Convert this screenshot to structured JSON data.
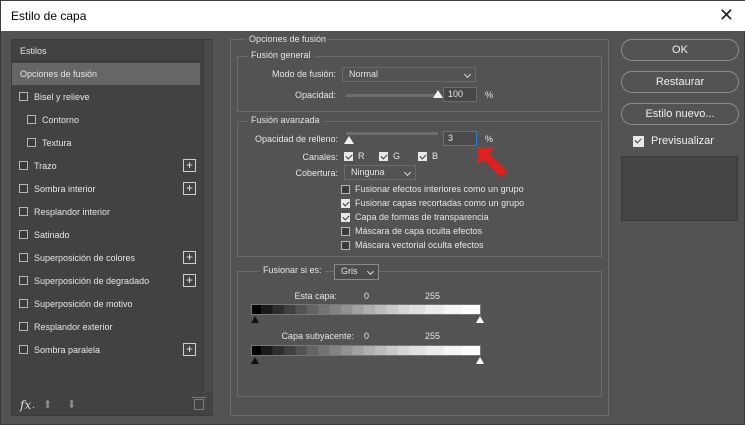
{
  "window": {
    "title": "Estilo de capa",
    "close_glyph": "✕"
  },
  "left_panel": {
    "header": "Estilos",
    "items": [
      {
        "label": "Opciones de fusión",
        "checkbox": false,
        "plus": false,
        "active": true
      },
      {
        "label": "Bisel y relieve",
        "checkbox": true,
        "checked": false,
        "plus": false
      },
      {
        "label": "Contorno",
        "checkbox": true,
        "checked": false,
        "plus": false,
        "indent": true
      },
      {
        "label": "Textura",
        "checkbox": true,
        "checked": false,
        "plus": false,
        "indent": true
      },
      {
        "label": "Trazo",
        "checkbox": true,
        "checked": false,
        "plus": true
      },
      {
        "label": "Sombra interior",
        "checkbox": true,
        "checked": false,
        "plus": true
      },
      {
        "label": "Resplandor interior",
        "checkbox": true,
        "checked": false,
        "plus": false
      },
      {
        "label": "Satinado",
        "checkbox": true,
        "checked": false,
        "plus": false
      },
      {
        "label": "Superposición de colores",
        "checkbox": true,
        "checked": false,
        "plus": true
      },
      {
        "label": "Superposición de degradado",
        "checkbox": true,
        "checked": false,
        "plus": true
      },
      {
        "label": "Superposición de motivo",
        "checkbox": true,
        "checked": false,
        "plus": false
      },
      {
        "label": "Resplandor exterior",
        "checkbox": true,
        "checked": false,
        "plus": false
      },
      {
        "label": "Sombra paralela",
        "checkbox": true,
        "checked": false,
        "plus": true
      }
    ],
    "fx_label": "fx",
    "fx_dot": ".",
    "up_icon": "⬆",
    "down_icon": "⬇"
  },
  "blend_options": {
    "title": "Opciones de fusión",
    "general": {
      "title": "Fusión general",
      "mode_label": "Modo de fusión:",
      "mode_value": "Normal",
      "opacity_label": "Opacidad:",
      "opacity_value": "100",
      "opacity_unit": "%",
      "opacity_level": 1.0
    },
    "advanced": {
      "title": "Fusión avanzada",
      "fill_label": "Opacidad de relleno:",
      "fill_value": "3",
      "fill_unit": "%",
      "fill_level": 0.03,
      "channels_label": "Canales:",
      "channels": [
        {
          "label": "R",
          "checked": true
        },
        {
          "label": "G",
          "checked": true
        },
        {
          "label": "B",
          "checked": true
        }
      ],
      "knockout_label": "Cobertura:",
      "knockout_value": "Ninguna",
      "options": [
        {
          "label": "Fusionar efectos interiores como un grupo",
          "checked": false
        },
        {
          "label": "Fusionar capas recortadas como un grupo",
          "checked": true
        },
        {
          "label": "Capa de formas de transparencia",
          "checked": true
        },
        {
          "label": "Máscara de capa oculta efectos",
          "checked": false
        },
        {
          "label": "Máscara vectorial oculta efectos",
          "checked": false
        }
      ]
    },
    "blend_if": {
      "label": "Fusionar si es:",
      "value": "Gris",
      "this_layer_label": "Esta capa:",
      "this_layer_min": "0",
      "this_layer_max": "255",
      "underlying_label": "Capa subyacente:",
      "underlying_min": "0",
      "underlying_max": "255"
    }
  },
  "buttons": {
    "ok": "OK",
    "reset": "Restaurar",
    "new_style": "Estilo nuevo...",
    "preview_label": "Previsualizar",
    "preview_checked": true
  },
  "colors": {
    "dialog_bg": "#535353",
    "panel_bg": "#424242",
    "active_item": "#666666",
    "focus_border": "#2f7fd0",
    "annotation_arrow": "#e0201f"
  }
}
